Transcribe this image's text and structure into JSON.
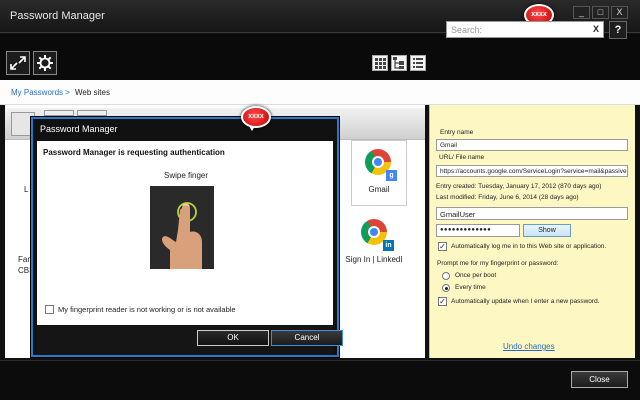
{
  "window": {
    "title": "Password Manager",
    "badge": "xxxx",
    "minimize": "_",
    "maximize": "□",
    "close": "X"
  },
  "toolbar": {
    "search_placeholder": "Search:",
    "search_clear": "X",
    "help": "?"
  },
  "breadcrumb": {
    "root": "My Passwords >",
    "current": "Web sites"
  },
  "tiles": {
    "gmail": "Gmail",
    "linkedin": "Sign In | LinkedI",
    "partial_1": "L",
    "partial_2": "Fam",
    "partial_3": "CBS"
  },
  "details": {
    "entry_name_label": "Entry name",
    "entry_name": "Gmail",
    "url_label": "URL/ File name",
    "url": "https://accounts.google.com/ServiceLogin?service=mail&passive",
    "created": "Entry created: Tuesday, January 17, 2012 (870 days ago)",
    "modified": "Last modified: Friday, June 6, 2014 (28 days ago)",
    "username": "GmailUser",
    "password": "●●●●●●●●●●●●●",
    "show_label": "Show",
    "auto_login": "Automatically log me in to this Web site or application.",
    "prompt_label": "Prompt me for my fingerprint or password:",
    "once_per_boot": "Once per boot",
    "every_time": "Every time",
    "auto_update": "Automatically update when I enter a new password.",
    "undo": "Undo changes"
  },
  "footer": {
    "close": "Close"
  },
  "dialog": {
    "title": "Password Manager",
    "badge": "xxxx",
    "heading": "Password Manager is requesting authentication",
    "swipe": "Swipe finger",
    "fallback": "My fingerprint reader is not working or is not available",
    "ok": "OK",
    "cancel": "Cancel"
  },
  "colors": {
    "accent_blue": "#2a78c8",
    "details_bg": "#fdf7c4",
    "link": "#2a6bbf",
    "badge_red": "#d40000"
  }
}
